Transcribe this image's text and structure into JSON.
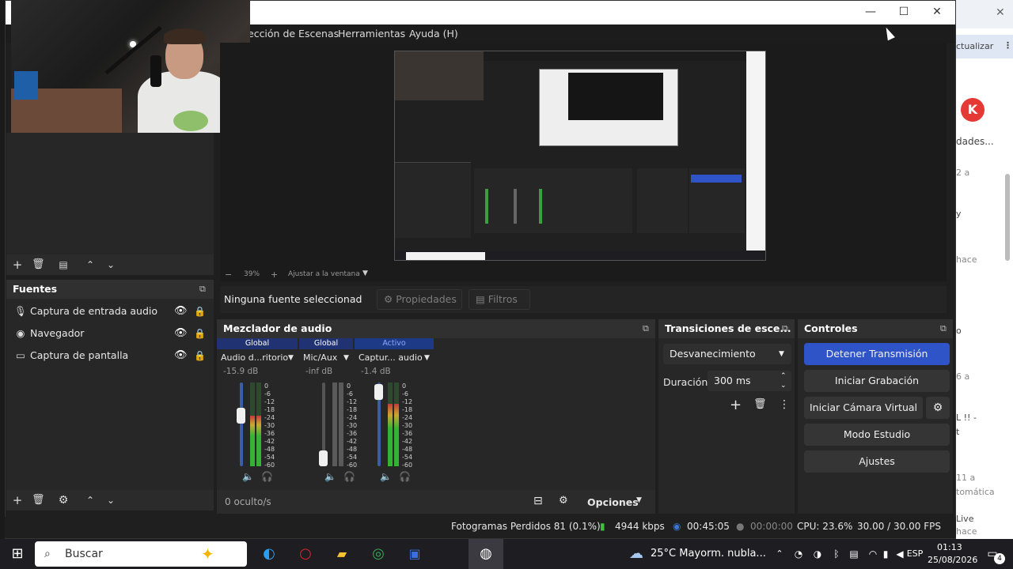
{
  "menu": {
    "items": [
      "ección de Escenas",
      "Herramientas",
      "Ayuda (H)"
    ]
  },
  "window_controls": {
    "minimize": "—",
    "maximize": "☐",
    "close": "✕"
  },
  "preview": {
    "zoom_minus": "−",
    "zoom_level": "39%",
    "zoom_plus": "+",
    "fit_label": "Ajustar a la ventana"
  },
  "source_toolbar": {
    "selected_source": "Ninguna fuente seleccionad",
    "properties_label": "Propiedades",
    "filters_label": "Filtros"
  },
  "sources": {
    "title": "Fuentes",
    "items": [
      {
        "label": "Captura de entrada audio",
        "icon": "microphone-icon"
      },
      {
        "label": "Navegador",
        "icon": "globe-icon"
      },
      {
        "label": "Captura de pantalla",
        "icon": "monitor-icon"
      }
    ]
  },
  "mixer": {
    "title": "Mezclador de audio",
    "channels": [
      {
        "header": "Global",
        "name": "Audio d...ritorio",
        "db": "-15.9 dB",
        "level": 0.6,
        "fader": 0.63,
        "muted": false
      },
      {
        "header": "Global",
        "name": "Mic/Aux",
        "db": "-inf dB",
        "level": 0.0,
        "fader": 0.0,
        "muted": true
      },
      {
        "header": "Activo",
        "name": "Captur... audio",
        "db": "-1.4 dB",
        "level": 0.75,
        "fader": 0.98,
        "muted": false
      }
    ],
    "scale": [
      "0",
      "-6",
      "-12",
      "-18",
      "-24",
      "-30",
      "-36",
      "-42",
      "-48",
      "-54",
      "-60"
    ],
    "hidden_label": "0 oculto/s",
    "options_label": "Opciones"
  },
  "transitions": {
    "title": "Transiciones de esce...",
    "selected": "Desvanecimiento",
    "duration_label": "Duración",
    "duration_value": "300 ms"
  },
  "controls": {
    "title": "Controles",
    "stop_stream": "Detener Transmisión",
    "start_recording": "Iniciar Grabación",
    "virtual_camera": "Iniciar Cámara Virtual",
    "studio_mode": "Modo Estudio",
    "settings": "Ajustes",
    "accent_color": "#2f54c8"
  },
  "status": {
    "dropped_frames": "Fotogramas Perdidos 81 (0.1%)",
    "bitrate": "4944 kbps",
    "stream_time": "00:45:05",
    "record_time": "00:00:00",
    "cpu": "CPU: 23.6%",
    "fps": "30.00 / 30.00 FPS"
  },
  "taskbar": {
    "search_placeholder": "Buscar",
    "weather": "25°C  Mayorm. nubla...",
    "language": "ESP",
    "time": "01:13",
    "date": "25/08/2026",
    "notifications": "4"
  },
  "browser": {
    "update_label": "ctualizar",
    "snippets": [
      "dades...",
      "2 a",
      "y",
      "hace",
      "o",
      "6 a",
      "L !! -",
      "t",
      "11 a",
      "tomática",
      "Live",
      "hace"
    ]
  }
}
